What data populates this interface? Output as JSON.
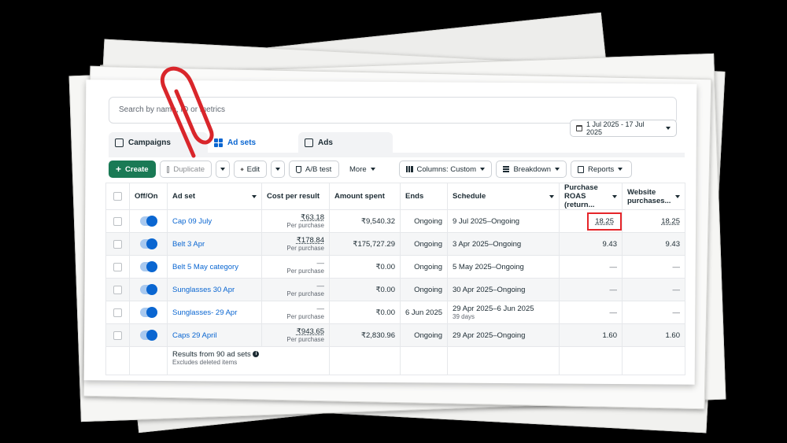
{
  "search": {
    "placeholder": "Search by name, ID or metrics"
  },
  "date_range": "1 Jul 2025 - 17 Jul 2025",
  "tabs": [
    {
      "label": "Campaigns"
    },
    {
      "label": "Ad sets"
    },
    {
      "label": "Ads"
    }
  ],
  "toolbar": {
    "create": "Create",
    "duplicate": "Duplicate",
    "edit": "Edit",
    "ab_test": "A/B test",
    "more": "More",
    "columns": "Columns: Custom",
    "breakdown": "Breakdown",
    "reports": "Reports"
  },
  "columns": {
    "off_on": "Off/On",
    "ad_set": "Ad set",
    "cost_per_result": "Cost per result",
    "amount_spent": "Amount spent",
    "ends": "Ends",
    "schedule": "Schedule",
    "purchase_roas_1": "Purchase",
    "purchase_roas_2": "ROAS (return...",
    "website_purchases_1": "Website",
    "website_purchases_2": "purchases..."
  },
  "rows": [
    {
      "name": "Cap 09 July",
      "cost": "₹63.18",
      "cost_sub": "Per purchase",
      "spent": "₹9,540.32",
      "ends": "Ongoing",
      "schedule": "9 Jul 2025–Ongoing",
      "schedule_sub": "",
      "roas": "18.25",
      "website": "18.25"
    },
    {
      "name": "Belt 3 Apr",
      "cost": "₹178.84",
      "cost_sub": "Per purchase",
      "spent": "₹175,727.29",
      "ends": "Ongoing",
      "schedule": "3 Apr 2025–Ongoing",
      "schedule_sub": "",
      "roas": "9.43",
      "website": "9.43"
    },
    {
      "name": "Belt 5 May category",
      "cost": "—",
      "cost_sub": "Per purchase",
      "spent": "₹0.00",
      "ends": "Ongoing",
      "schedule": "5 May 2025–Ongoing",
      "schedule_sub": "",
      "roas": "—",
      "website": "—"
    },
    {
      "name": "Sunglasses 30 Apr",
      "cost": "—",
      "cost_sub": "Per purchase",
      "spent": "₹0.00",
      "ends": "Ongoing",
      "schedule": "30 Apr 2025–Ongoing",
      "schedule_sub": "",
      "roas": "—",
      "website": "—"
    },
    {
      "name": "Sunglasses- 29 Apr",
      "cost": "—",
      "cost_sub": "Per purchase",
      "spent": "₹0.00",
      "ends": "6 Jun 2025",
      "schedule": "29 Apr 2025–6 Jun 2025",
      "schedule_sub": "39 days",
      "roas": "—",
      "website": "—"
    },
    {
      "name": "Caps 29 April",
      "cost": "₹943.65",
      "cost_sub": "Per purchase",
      "spent": "₹2,830.96",
      "ends": "Ongoing",
      "schedule": "29 Apr 2025–Ongoing",
      "schedule_sub": "",
      "roas": "1.60",
      "website": "1.60"
    }
  ],
  "footer": {
    "results": "Results from 90 ad sets",
    "sub": "Excludes deleted items"
  },
  "colors": {
    "accent_blue": "#0a66d1",
    "create_green": "#1a7a55",
    "highlight_red": "#e5252a",
    "paperclip_red": "#d9262b"
  },
  "icons": [
    "calendar-icon",
    "campaigns-icon",
    "grid-icon",
    "ads-icon",
    "plus-icon",
    "copy-icon",
    "pencil-icon",
    "flask-icon",
    "columns-icon",
    "breakdown-icon",
    "reports-icon",
    "info-icon",
    "paperclip-icon"
  ]
}
